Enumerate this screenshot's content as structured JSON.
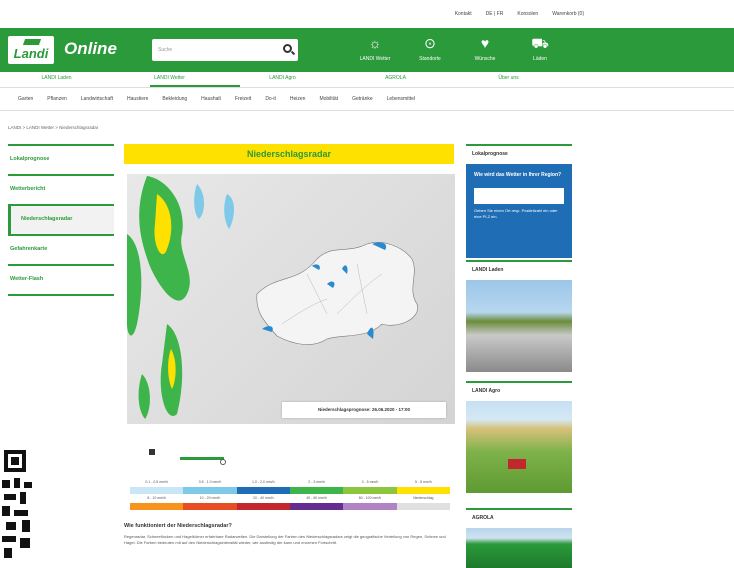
{
  "topbar": {
    "items": [
      "Kontakt",
      "DE | FR",
      "Konsolen",
      "Warenkorb (0)"
    ]
  },
  "header": {
    "logo": "Landi",
    "brand": "Online",
    "search_placeholder": "Suche",
    "icons": [
      {
        "name": "weather-icon",
        "label": "LANDI Wetter",
        "glyph": "☼"
      },
      {
        "name": "location-icon",
        "label": "Standorte",
        "glyph": "⊙"
      },
      {
        "name": "wish-icon",
        "label": "Wünsche",
        "glyph": "♥"
      },
      {
        "name": "cart-icon",
        "label": "Läden",
        "glyph": "⛟"
      }
    ]
  },
  "subnav": [
    "LANDI Laden",
    "LANDI Wetter",
    "LANDI Agro",
    "AGROLA",
    "Über uns"
  ],
  "catnav": [
    "Garten",
    "Pflanzen",
    "Landwirtschaft",
    "Haustiere",
    "Bekleidung",
    "Haushalt",
    "Freizeit",
    "Do-it",
    "Heizen",
    "Mobilität",
    "Getränke",
    "Lebensmittel"
  ],
  "breadcrumb": "LANDI > LANDI Wetter > Niederschlagsradar",
  "sidebar": [
    "Lokalprognose",
    "Wetterbericht",
    "Niederschlagsradar",
    "Gefahrenkarte",
    "Wetter-Flash"
  ],
  "main": {
    "title": "Niederschlagsradar",
    "caption": "Niederschlagsprognose: 26.06.2020 - 17:00",
    "legend_labels_row1": [
      "0.1 - 0.5 mm/h",
      "0.5 - 1.0 mm/h",
      "1.0 - 2.0 mm/h",
      "2 - 3 mm/h",
      "3 - 5 mm/h",
      "5 - 8 mm/h"
    ],
    "legend_labels_row2": [
      "8 - 10 mm/h",
      "10 - 20 mm/h",
      "20 - 40 mm/h",
      "40 - 60 mm/h",
      "60 - 100 mm/h",
      "Niederschlag"
    ],
    "question": "Wie funktioniert der Niederschlagsradar?",
    "text": "Regenradar, Schneeflocken und Hagelkörner erfahrbare Radarwelten. Die Darstellung der Farben des Niederschlagsradars zeigt die geografische Verteilung von Regen, Schnee und Hagel. Die Farben bedeuten mit auf den Niederschlagsintensität wieder, wie ausfindig der kann und enormen Fortschritt."
  },
  "right": {
    "lokal": {
      "title": "Lokalprognose",
      "question": "Wie wird das Wetter in Ihrer Region?",
      "hint": "Geben Sie einen Ort resp. Postleitzahl ein oder eine PLZ ein."
    },
    "cards": [
      "LANDI Laden",
      "LANDI Agro",
      "AGROLA"
    ]
  },
  "colors": {
    "brand": "#2a9a3a",
    "title_bg": "#ffe100",
    "lokal_bg": "#1f6db5"
  }
}
